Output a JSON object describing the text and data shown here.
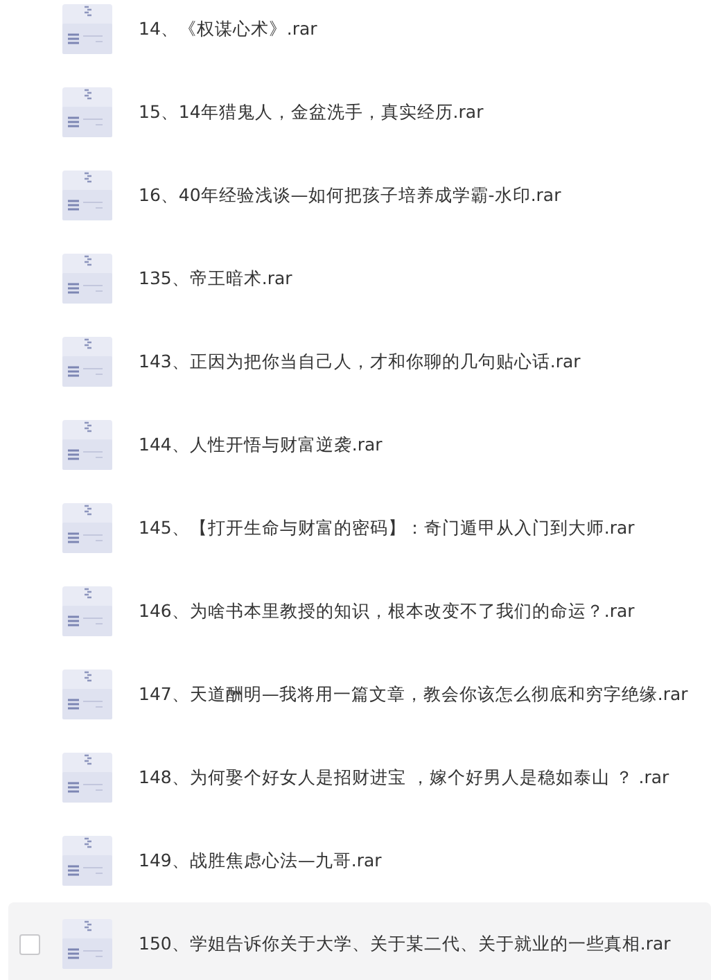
{
  "files": [
    {
      "name": "14、《权谋心术》.rar"
    },
    {
      "name": "15、14年猎鬼人，金盆洗手，真实经历.rar"
    },
    {
      "name": "16、40年经验浅谈—如何把孩子培养成学霸-水印.rar"
    },
    {
      "name": "135、帝王暗术.rar"
    },
    {
      "name": "143、正因为把你当自己人，才和你聊的几句贴心话.rar"
    },
    {
      "name": "144、人性开悟与财富逆袭.rar"
    },
    {
      "name": "145、【打开生命与财富的密码】：奇门遁甲从入门到大师.rar"
    },
    {
      "name": "146、为啥书本里教授的知识，根本改变不了我们的命运？.rar"
    },
    {
      "name": "147、天道酬明—我将用一篇文章，教会你该怎么彻底和穷字绝缘.rar"
    },
    {
      "name": "148、为何娶个好女人是招财进宝 ，嫁个好男人是稳如泰山 ？ .rar"
    },
    {
      "name": "149、战胜焦虑心法—九哥.rar"
    },
    {
      "name": "150、学姐告诉你关于大学、关于某二代、关于就业的一些真相.rar",
      "checkbox": {
        "checked": false
      }
    }
  ]
}
